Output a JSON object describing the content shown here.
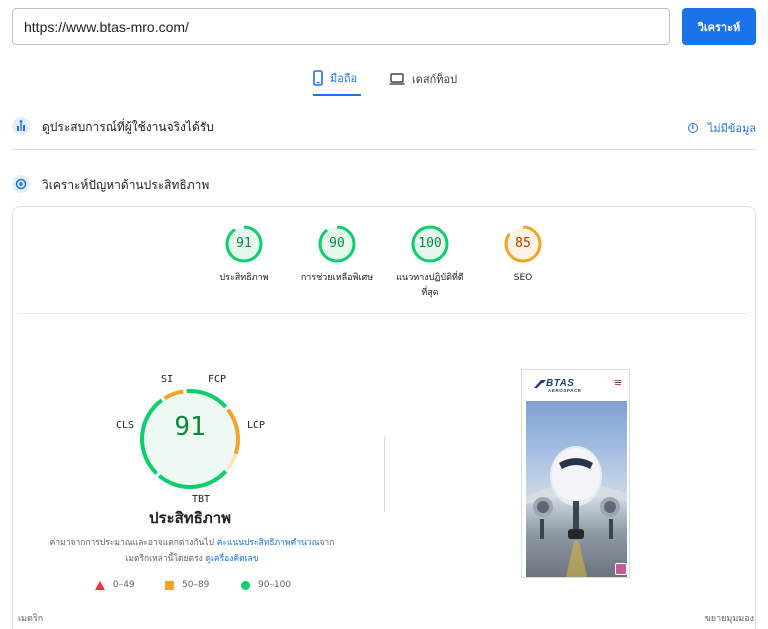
{
  "url_bar": {
    "value": "https://www.btas-mro.com/"
  },
  "analyze_button": {
    "label": "วิเคราะห์"
  },
  "tabs": [
    {
      "label": "มือถือ",
      "active": true
    },
    {
      "label": "เดสก์ท็อป",
      "active": false
    }
  ],
  "field_data": {
    "title": "ดูประสบการณ์ที่ผู้ใช้งานจริงได้รับ",
    "no_data_label": "ไม่มีข้อมูล"
  },
  "lab_section": {
    "title": "วิเคราะห์ปัญหาด้านประสิทธิภาพ"
  },
  "scores": [
    {
      "value": "91",
      "label": "ประสิทธิภาพ",
      "color": "#0cce6b",
      "fraction": 0.91
    },
    {
      "value": "90",
      "label": "การช่วยเหลือพิเศษ",
      "color": "#0cce6b",
      "fraction": 0.9
    },
    {
      "value": "100",
      "label": "แนวทางปฏิบัติที่ดีที่สุด",
      "color": "#0cce6b",
      "fraction": 1.0
    },
    {
      "value": "85",
      "label": "SEO",
      "color": "#f4a32a",
      "fraction": 0.85
    }
  ],
  "performance": {
    "score": "91",
    "title": "ประสิทธิภาพ",
    "metric_labels": {
      "si": "SI",
      "fcp": "FCP",
      "lcp": "LCP",
      "tbt": "TBT",
      "cls": "CLS"
    },
    "note_prefix": "ค่ามาจากการประมาณและอาจแตกต่างกันไป",
    "note_link1": "คะแนนประสิทธิภาพคำนวณ",
    "note_mid": "จากเมตริกเหล่านี้โดยตรง",
    "note_link2": "ดูเครื่องคิดเลข"
  },
  "legend": [
    {
      "range": "0–49",
      "shape": "triangle",
      "color": "#e53935"
    },
    {
      "range": "50–89",
      "shape": "square",
      "color": "#f4a32a"
    },
    {
      "range": "90–100",
      "shape": "circle",
      "color": "#0cce6b"
    }
  ],
  "preview": {
    "logo_text": "BTAS",
    "logo_sub": "AEROSPACE"
  },
  "footer": {
    "metrics_label": "เมตริก",
    "expand_label": "ขยายมุมมอง"
  },
  "colors": {
    "accent": "#1a73e8",
    "pass": "#0cce6b",
    "average": "#f4a32a",
    "fail": "#e53935"
  }
}
